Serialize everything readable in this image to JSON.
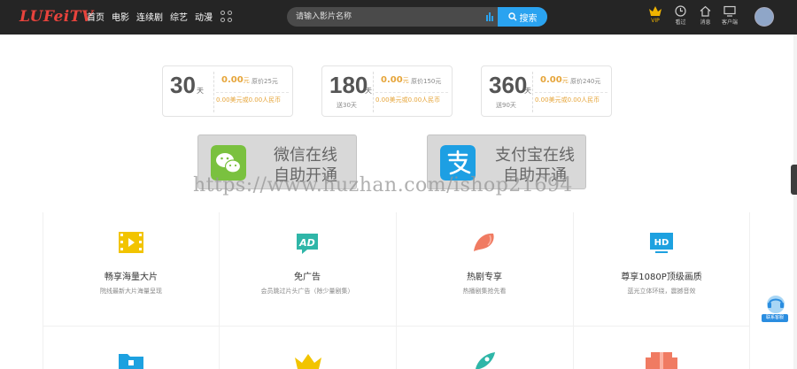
{
  "header": {
    "logo_main": "LUFei",
    "logo_tv": "TV",
    "nav": [
      "首页",
      "电影",
      "连续剧",
      "综艺",
      "动漫"
    ],
    "search_placeholder": "请输入影片名称",
    "search_button": "搜索",
    "icons": [
      {
        "name": "vip-crown-icon",
        "label": "VIP"
      },
      {
        "name": "clock-icon",
        "label": "看过"
      },
      {
        "name": "home-icon",
        "label": "消息"
      },
      {
        "name": "monitor-icon",
        "label": "客户端"
      }
    ]
  },
  "plans": [
    {
      "days": "30",
      "unit": "天",
      "gift": "",
      "price": "0.00",
      "price_unit": "元",
      "original": "原价25元",
      "daily": "0.00美元或0.00人民币"
    },
    {
      "days": "180",
      "unit": "天",
      "gift": "送30天",
      "price": "0.00",
      "price_unit": "元",
      "original": "原价150元",
      "daily": "0.00美元或0.00人民币"
    },
    {
      "days": "360",
      "unit": "天",
      "gift": "送90天",
      "price": "0.00",
      "price_unit": "元",
      "original": "原价240元",
      "daily": "0.00美元或0.00人民币"
    }
  ],
  "payments": [
    {
      "line1": "微信在线",
      "line2": "自助开通",
      "color": "#7ac13f"
    },
    {
      "line1": "支付宝在线",
      "line2": "自助开通",
      "color": "#1d9fe3"
    }
  ],
  "watermark": "https://www.huzhan.com/ishop21694",
  "features": [
    {
      "title": "畅享海量大片",
      "desc": "院线最新大片海量呈现",
      "icon": "film-icon",
      "color": "#f2c400"
    },
    {
      "title": "免广告",
      "desc": "会员跳过片头广告（除少量剧集）",
      "icon": "ad-icon",
      "color": "#2fb6a8"
    },
    {
      "title": "热剧专享",
      "desc": "热播剧集抢先看",
      "icon": "fish-icon",
      "color": "#f07b62"
    },
    {
      "title": "尊享1080P顶级画质",
      "desc": "蓝光立体环绕，震撼音效",
      "icon": "hd-icon",
      "color": "#1da1e0"
    }
  ],
  "service_label": "联系客服"
}
